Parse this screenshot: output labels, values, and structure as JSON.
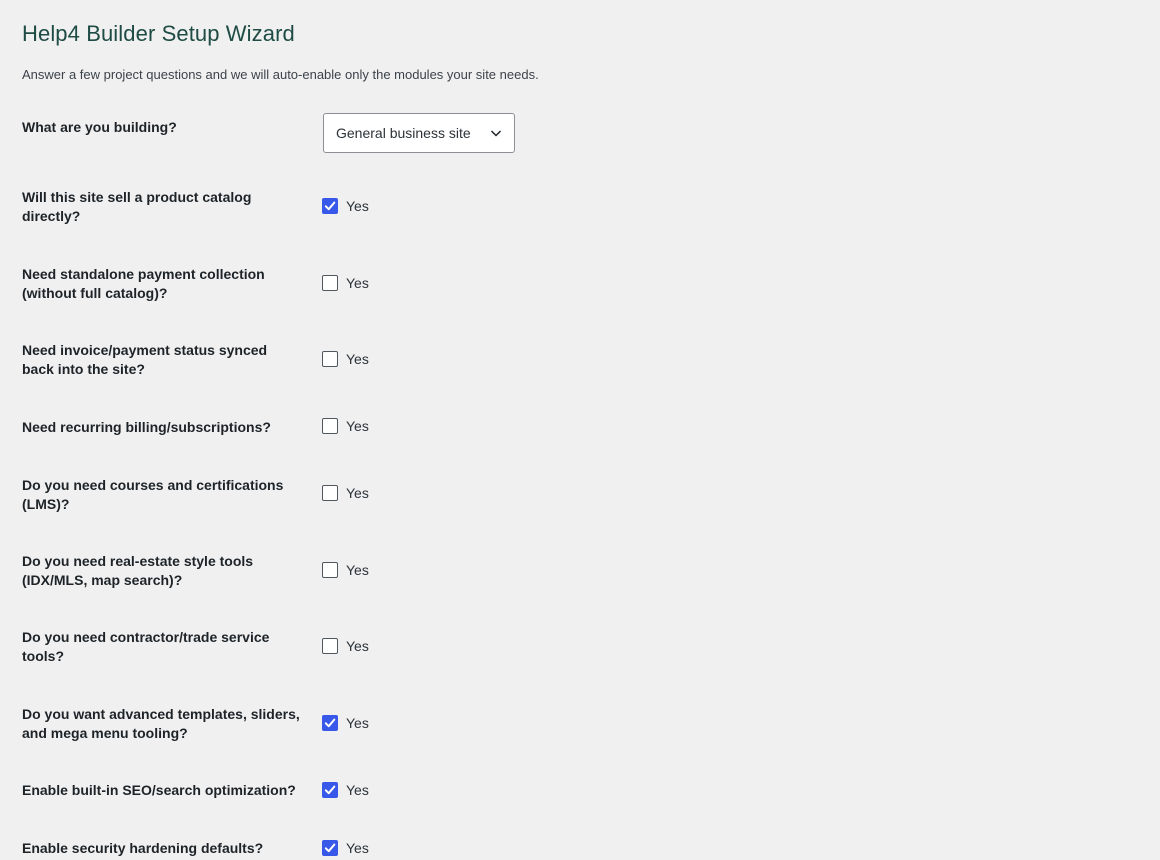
{
  "page": {
    "title": "Help4 Builder Setup Wizard",
    "intro": "Answer a few project questions and we will auto-enable only the modules your site needs."
  },
  "building": {
    "label": "What are you building?",
    "selected": "General business site"
  },
  "questions": [
    {
      "label": "Will this site sell a product catalog directly?",
      "option": "Yes",
      "checked": true
    },
    {
      "label": "Need standalone payment collection (without full catalog)?",
      "option": "Yes",
      "checked": false
    },
    {
      "label": "Need invoice/payment status synced back into the site?",
      "option": "Yes",
      "checked": false
    },
    {
      "label": "Need recurring billing/subscriptions?",
      "option": "Yes",
      "checked": false
    },
    {
      "label": "Do you need courses and certifications (LMS)?",
      "option": "Yes",
      "checked": false
    },
    {
      "label": "Do you need real-estate style tools (IDX/MLS, map search)?",
      "option": "Yes",
      "checked": false
    },
    {
      "label": "Do you need contractor/trade service tools?",
      "option": "Yes",
      "checked": false
    },
    {
      "label": "Do you want advanced templates, sliders, and mega menu tooling?",
      "option": "Yes",
      "checked": true
    },
    {
      "label": "Enable built-in SEO/search optimization?",
      "option": "Yes",
      "checked": true
    },
    {
      "label": "Enable security hardening defaults?",
      "option": "Yes",
      "checked": true
    }
  ],
  "colors": {
    "title": "#1e4b44",
    "checkbox_checked": "#3858e9",
    "background": "#f0f0f1"
  }
}
